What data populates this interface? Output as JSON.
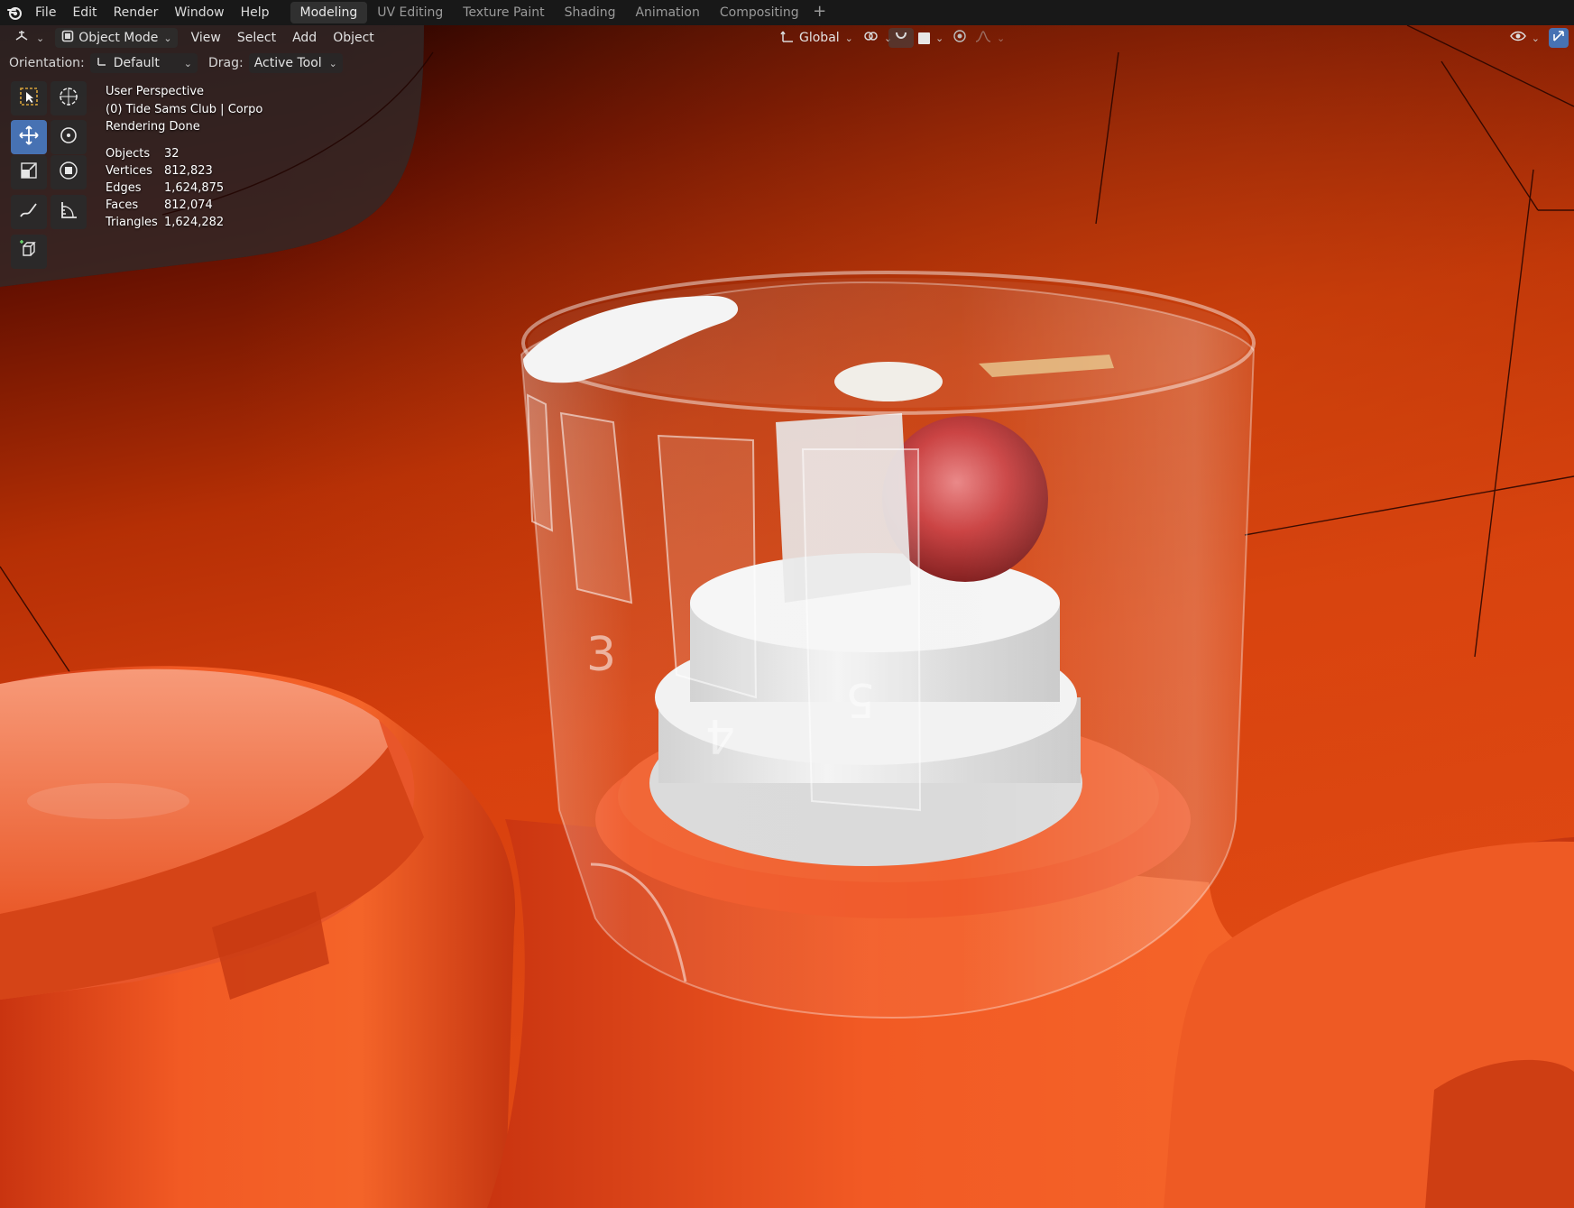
{
  "menubar": {
    "logo_icon": "blender-logo-icon",
    "menus": [
      "File",
      "Edit",
      "Render",
      "Window",
      "Help"
    ],
    "workspaces": [
      {
        "label": "Modeling",
        "active": true
      },
      {
        "label": "UV Editing",
        "active": false
      },
      {
        "label": "Texture Paint",
        "active": false
      },
      {
        "label": "Shading",
        "active": false
      },
      {
        "label": "Animation",
        "active": false
      },
      {
        "label": "Compositing",
        "active": false
      }
    ],
    "add_workspace": "+"
  },
  "viewport_header": {
    "editor_type_icon": "viewport-editor-icon",
    "mode": "Object Mode",
    "menus": [
      "View",
      "Select",
      "Add",
      "Object"
    ],
    "transform_orientation": "Global",
    "icons": [
      "pivot-icon",
      "snap-icon",
      "proportional-edit-icon",
      "viewport-gizmo-icon",
      "overlay-icon"
    ]
  },
  "tool_settings": {
    "orientation_label": "Orientation:",
    "orientation_value": "Default",
    "drag_label": "Drag:",
    "drag_value": "Active Tool"
  },
  "toolbar": {
    "tools": [
      "select-box-tool",
      "cursor-tool",
      "move-tool",
      "rotate-tool",
      "scale-tool",
      "transform-tool",
      "annotate-tool",
      "measure-tool",
      "add-cube-tool"
    ],
    "active_tool": "move-tool"
  },
  "overlay": {
    "perspective": "User Perspective",
    "collection": "(0) Tide Sams Club | Corpo",
    "render_status": "Rendering Done",
    "stats": [
      {
        "label": "Objects",
        "value": "32"
      },
      {
        "label": "Vertices",
        "value": "812,823"
      },
      {
        "label": "Edges",
        "value": "1,624,875"
      },
      {
        "label": "Faces",
        "value": "812,074"
      },
      {
        "label": "Triangles",
        "value": "1,624,282"
      }
    ]
  },
  "scene": {
    "background_dark": "#2a0400",
    "background_orange": "#d8400e",
    "bottle_orange": "#ef4a19",
    "cap_white": "#ecebea",
    "ball_red": "#c83a3a",
    "cup_numbers": [
      "3",
      "4",
      "5"
    ]
  },
  "colors": {
    "menubar": "#181818",
    "active_blue": "#4772b3"
  }
}
